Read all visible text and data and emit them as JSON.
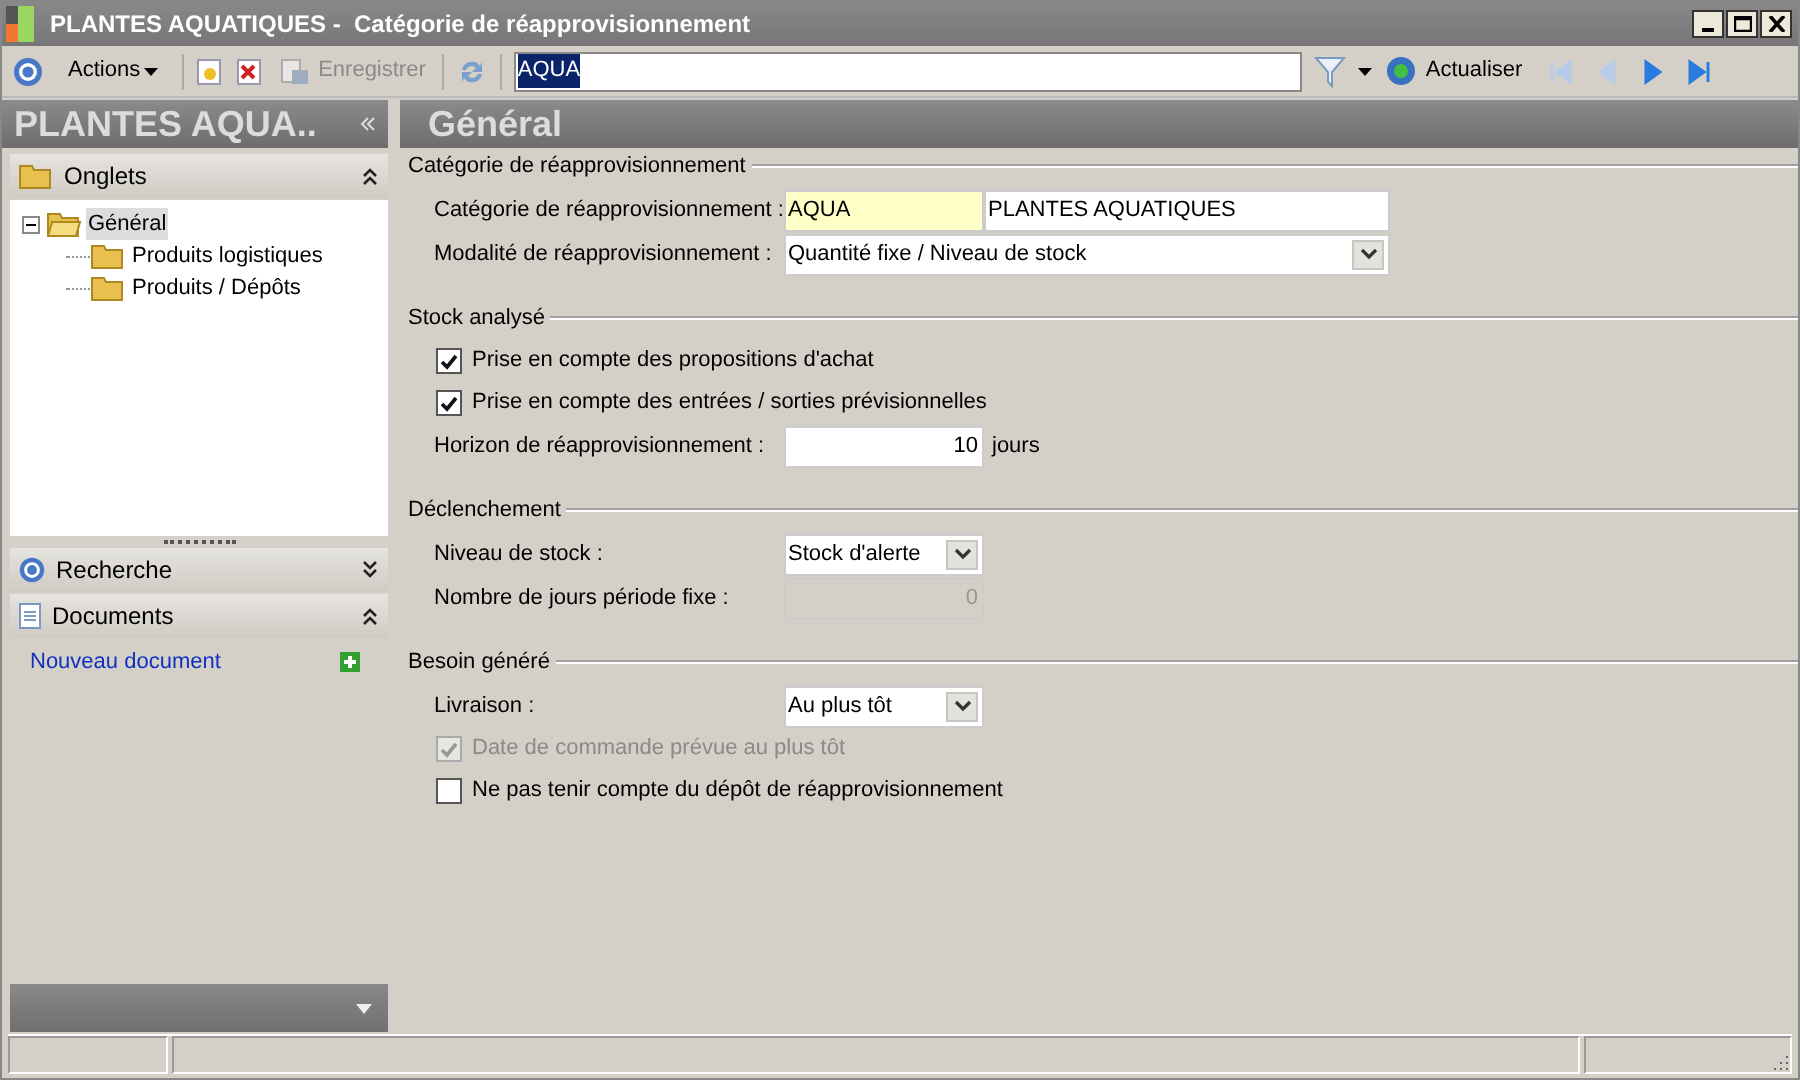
{
  "window": {
    "title": "PLANTES AQUATIQUES -  Catégorie de réapprovisionnement"
  },
  "toolbar": {
    "actions": "Actions",
    "save": {
      "label": "Enregistrer",
      "disabled": true
    },
    "search": {
      "value": "AQUA",
      "highlighted": true
    },
    "refresh": "Actualiser",
    "nav": [
      {
        "kind": "first",
        "disabled": true
      },
      {
        "kind": "prev",
        "disabled": true
      },
      {
        "kind": "next",
        "disabled": false
      },
      {
        "kind": "last",
        "disabled": false
      }
    ]
  },
  "sidebar": {
    "title": "PLANTES AQUA..",
    "panels": [
      {
        "title": "Onglets",
        "expanded": true,
        "tree": [
          {
            "label": "Général",
            "selected": true,
            "expanded": true,
            "children": [
              {
                "label": "Produits logistiques",
                "selected": false
              },
              {
                "label": "Produits / Dépôts",
                "selected": false
              }
            ]
          }
        ]
      },
      {
        "title": "Recherche",
        "expanded": false
      },
      {
        "title": "Documents",
        "expanded": true,
        "link": "Nouveau document"
      }
    ]
  },
  "main": {
    "title": "Général",
    "sections": [
      {
        "title": "Catégorie de réapprovisionnement",
        "fields": [
          {
            "kind": "code",
            "label": "Catégorie de réapprovisionnement :",
            "code": "AQUA",
            "value": "PLANTES AQUATIQUES"
          },
          {
            "kind": "select",
            "label": "Modalité de réapprovisionnement :",
            "value": "Quantité fixe / Niveau de stock",
            "wide": true
          }
        ]
      },
      {
        "title": "Stock analysé",
        "fields": [
          {
            "kind": "checkbox",
            "label": "Prise en compte des propositions d'achat",
            "checked": true,
            "disabled": false
          },
          {
            "kind": "checkbox",
            "label": "Prise en compte des entrées / sorties prévisionnelles",
            "checked": true,
            "disabled": false
          },
          {
            "kind": "number",
            "label": "Horizon de réapprovisionnement :",
            "value": "10",
            "unit": "jours",
            "disabled": false
          }
        ]
      },
      {
        "title": "Déclenchement",
        "fields": [
          {
            "kind": "select",
            "label": "Niveau de stock :",
            "value": "Stock d'alerte",
            "wide": false
          },
          {
            "kind": "number",
            "label": "Nombre de jours période fixe :",
            "value": "0",
            "disabled": true
          }
        ]
      },
      {
        "title": "Besoin généré",
        "fields": [
          {
            "kind": "select",
            "label": "Livraison :",
            "value": "Au plus tôt",
            "wide": false
          },
          {
            "kind": "checkbox",
            "label": "Date de commande prévue au plus tôt",
            "checked": true,
            "disabled": true
          },
          {
            "kind": "checkbox",
            "label": "Ne pas tenir compte du dépôt de réapprovisionnement",
            "checked": false,
            "disabled": false
          }
        ]
      }
    ]
  }
}
